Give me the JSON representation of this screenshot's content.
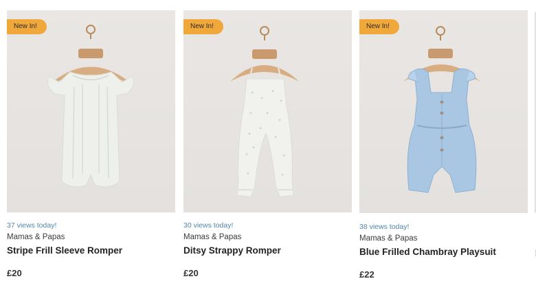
{
  "products": [
    {
      "badge": "New In!",
      "views": "37 views today!",
      "brand": "Mamas & Papas",
      "name": "Stripe Frill Sleeve Romper",
      "price": "£20",
      "garment_color": "#eef0ec"
    },
    {
      "badge": "New In!",
      "views": "30 views today!",
      "brand": "Mamas & Papas",
      "name": "Ditsy Strappy Romper",
      "price": "£20",
      "garment_color": "#f1f2ee"
    },
    {
      "badge": "New In!",
      "views": "38 views today!",
      "brand": "Mamas & Papas",
      "name": "Blue Frilled Chambray Playsuit",
      "price": "£22",
      "garment_color": "#a9c6e3"
    }
  ],
  "colors": {
    "badge_bg": "#f0a83a",
    "views_text": "#4f86a6",
    "image_bg": "#e7e4e1"
  }
}
